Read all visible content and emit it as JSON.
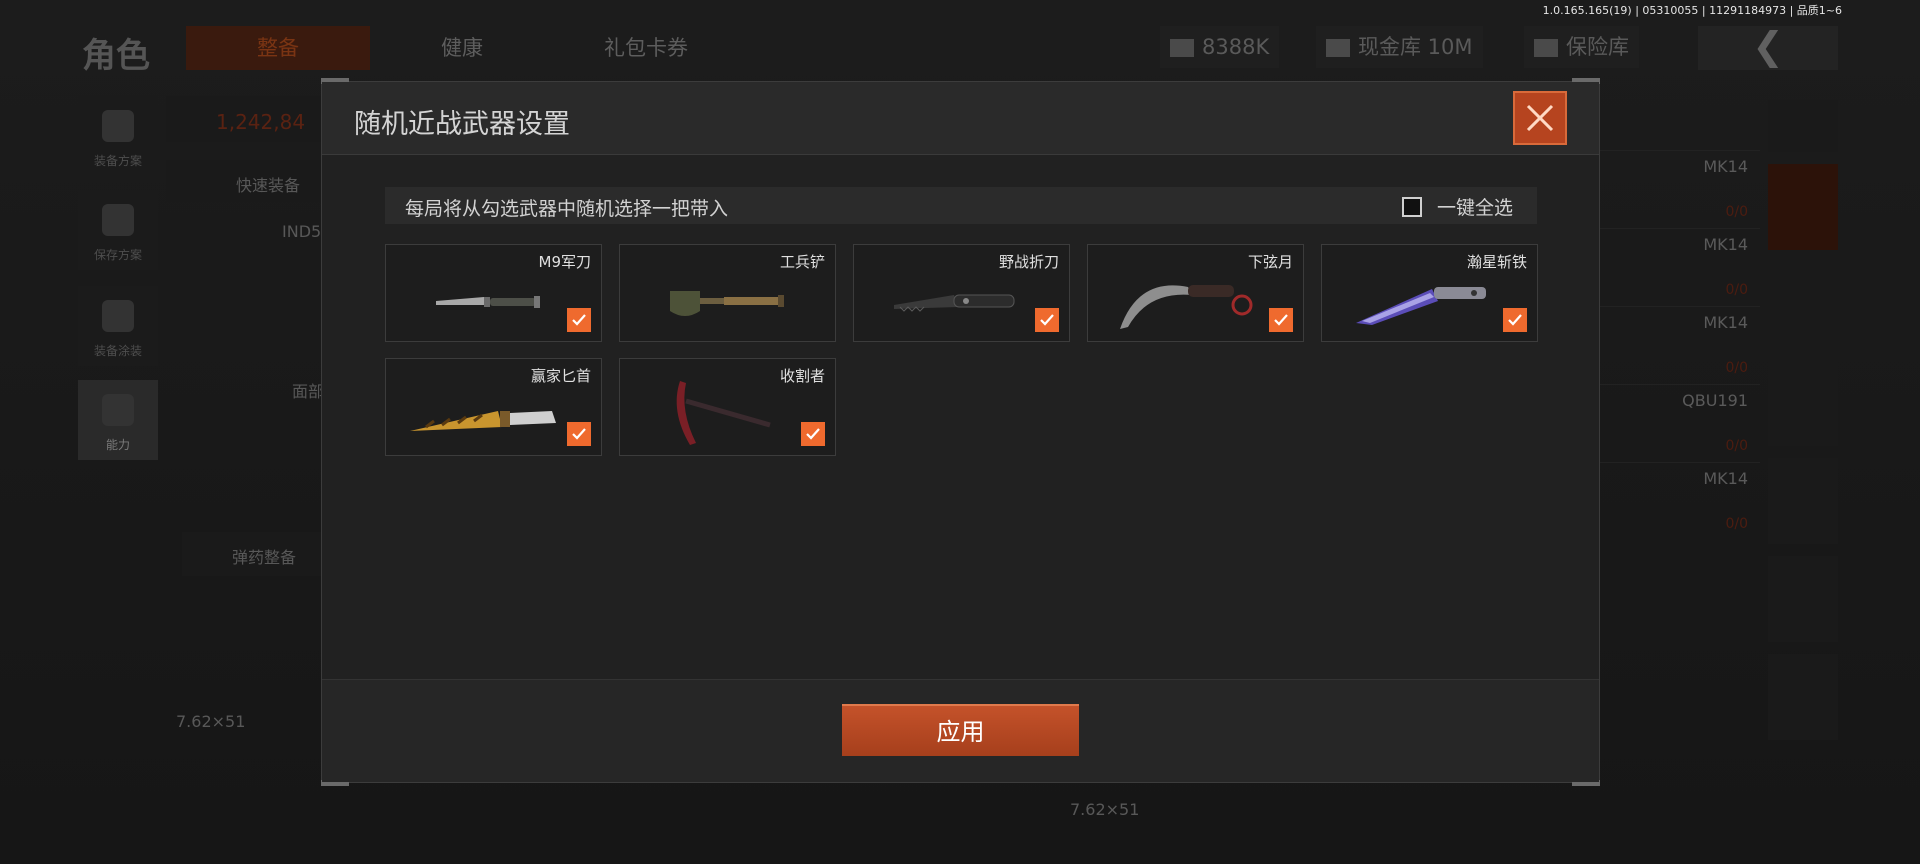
{
  "version_text": "1.0.165.165(19) | 05310055 | 11291184973 | 品质1~6",
  "background": {
    "title": "角色",
    "tabs": [
      "整备",
      "健康",
      "礼包卡券"
    ],
    "currencies": [
      "8388K",
      "现金库 10M",
      "保险库"
    ],
    "nav_items": [
      "装备方案",
      "保存方案",
      "装备涂装",
      "能力"
    ],
    "quick_equip": "快速装备",
    "ammo_manage": "弹药整备",
    "armor_value": "1,242,84",
    "helmet_name": "IND5",
    "face_label": "面部",
    "caliber": "7.62×51",
    "list": [
      {
        "name": "MK14",
        "count": "0/0"
      },
      {
        "name": "MK14",
        "count": "0/0"
      },
      {
        "name": "MK14",
        "count": "0/0"
      },
      {
        "name": "QBU191",
        "count": "0/0"
      },
      {
        "name": "MK14",
        "count": "0/0"
      }
    ]
  },
  "modal": {
    "title": "随机近战武器设置",
    "close_icon": "close-x-icon",
    "description": "每局将从勾选武器中随机选择一把带入",
    "select_all_label": "一键全选",
    "select_all_checked": false,
    "weapons": [
      {
        "name": "M9军刀",
        "checked": true,
        "icon": "bayonet-icon"
      },
      {
        "name": "工兵铲",
        "checked": false,
        "icon": "shovel-icon"
      },
      {
        "name": "野战折刀",
        "checked": true,
        "icon": "folding-knife-icon"
      },
      {
        "name": "下弦月",
        "checked": true,
        "icon": "karambit-icon"
      },
      {
        "name": "瀚星斩铁",
        "checked": true,
        "icon": "tanto-icon"
      },
      {
        "name": "赢家匕首",
        "checked": true,
        "icon": "dagger-icon"
      },
      {
        "name": "收割者",
        "checked": true,
        "icon": "scythe-icon"
      }
    ],
    "apply_label": "应用",
    "accent_color": "#ef6a2e"
  }
}
